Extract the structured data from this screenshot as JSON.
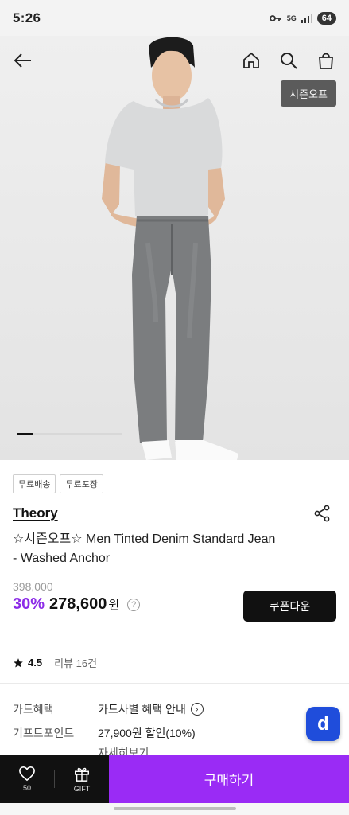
{
  "status_bar": {
    "time": "5:26",
    "battery": "64",
    "network": "5G"
  },
  "nav": {
    "back_icon": "arrow-left-icon",
    "home_icon": "home-icon",
    "search_icon": "search-icon",
    "cart_icon": "shopping-bag-icon"
  },
  "hero": {
    "badge": "시즌오프",
    "image_progress": 0.15
  },
  "product": {
    "tags": [
      "무료배송",
      "무료포장"
    ],
    "brand": "Theory",
    "title": "☆시즌오프☆ Men Tinted Denim Standard Jean - Washed Anchor",
    "original_price": "398,000",
    "discount": "30%",
    "price": "278,600",
    "currency": "원",
    "help": "?",
    "coupon_label": "쿠폰다운",
    "rating": "4.5",
    "review_label": "리뷰 16건"
  },
  "info": {
    "card_label": "카드혜택",
    "card_value": "카드사별 혜택 안내",
    "gift_label": "기프트포인트",
    "gift_value": "27,900원 할인(10%)",
    "detail_link": "자세히보기",
    "fab_label": "d"
  },
  "bottom_bar": {
    "like_count": "50",
    "gift_label": "GIFT",
    "buy_label": "구매하기"
  },
  "colors": {
    "accent": "#9a2bf5",
    "discount": "#8c2be8",
    "fab": "#1f4ddb"
  }
}
